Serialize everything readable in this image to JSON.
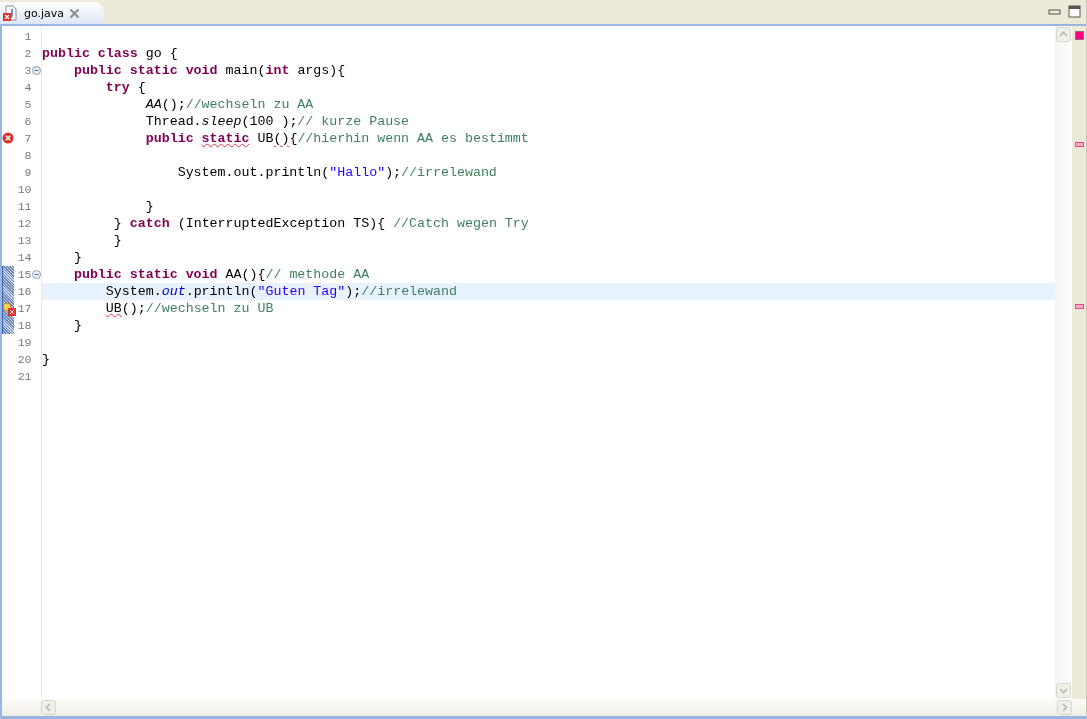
{
  "tab": {
    "title": "go.java",
    "selected": true,
    "has_error": true
  },
  "lines": [
    {
      "number": "1"
    },
    {
      "number": "2",
      "tokens": [
        {
          "kind": "keyword",
          "text": "public class"
        },
        {
          "kind": "plain",
          "text": " go {"
        }
      ]
    },
    {
      "number": "3",
      "expanded": true,
      "tokens": [
        {
          "kind": "keyword",
          "text": "    public static void"
        },
        {
          "kind": "plain",
          "text": " main("
        },
        {
          "kind": "keyword",
          "text": "int"
        },
        {
          "kind": "plain",
          "text": " args){"
        }
      ]
    },
    {
      "number": "4",
      "tokens": [
        {
          "kind": "keyword",
          "text": "        try"
        },
        {
          "kind": "plain",
          "text": " {"
        }
      ]
    },
    {
      "number": "5",
      "tokens": [
        {
          "kind": "italic",
          "text": "             AA"
        },
        {
          "kind": "plain",
          "text": "();"
        },
        {
          "kind": "comment",
          "text": "//wechseln zu AA"
        }
      ]
    },
    {
      "number": "6",
      "tokens": [
        {
          "kind": "plain",
          "text": "             Thread."
        },
        {
          "kind": "italic",
          "text": "sleep"
        },
        {
          "kind": "plain",
          "text": "(100 );"
        },
        {
          "kind": "comment",
          "text": "// kurze Pause"
        }
      ]
    },
    {
      "number": "7",
      "has_error": true,
      "tokens": [
        {
          "kind": "keyword",
          "text": "             public "
        },
        {
          "kind": "keyword",
          "text": "static",
          "error": true
        },
        {
          "kind": "plain",
          "text": " UB"
        },
        {
          "kind": "plain",
          "text": "()",
          "error": true
        },
        {
          "kind": "plain",
          "text": "{"
        },
        {
          "kind": "comment",
          "text": "//hierhin wenn AA es bestimmt"
        }
      ]
    },
    {
      "number": "8"
    },
    {
      "number": "9",
      "tokens": [
        {
          "kind": "plain",
          "text": "                 System.out.println("
        },
        {
          "kind": "string",
          "text": "\"Hallo\""
        },
        {
          "kind": "plain",
          "text": ");"
        },
        {
          "kind": "comment",
          "text": "//irrelewand"
        }
      ]
    },
    {
      "number": "10"
    },
    {
      "number": "11",
      "tokens": [
        {
          "kind": "plain",
          "text": "             }"
        }
      ]
    },
    {
      "number": "12",
      "tokens": [
        {
          "kind": "plain",
          "text": "         } "
        },
        {
          "kind": "keyword",
          "text": "catch"
        },
        {
          "kind": "plain",
          "text": " (InterruptedException TS){ "
        },
        {
          "kind": "comment",
          "text": "//Catch wegen Try"
        }
      ]
    },
    {
      "number": "13",
      "tokens": [
        {
          "kind": "plain",
          "text": "         }"
        }
      ]
    },
    {
      "number": "14",
      "tokens": [
        {
          "kind": "plain",
          "text": "    }"
        }
      ]
    },
    {
      "number": "15",
      "expanded": true,
      "range": true,
      "tokens": [
        {
          "kind": "keyword",
          "text": "    public static void"
        },
        {
          "kind": "plain",
          "text": " AA(){"
        },
        {
          "kind": "comment",
          "text": "// methode AA"
        }
      ]
    },
    {
      "number": "16",
      "range": true,
      "selected": true,
      "tokens": [
        {
          "kind": "plain",
          "text": "        System."
        },
        {
          "kind": "field",
          "text": "out"
        },
        {
          "kind": "plain",
          "text": ".println("
        },
        {
          "kind": "string",
          "text": "\"Guten Tag\""
        },
        {
          "kind": "plain",
          "text": ");"
        },
        {
          "kind": "comment",
          "text": "//irrelewand"
        }
      ]
    },
    {
      "number": "17",
      "has_error": true,
      "quick_fix": true,
      "range": true,
      "tokens": [
        {
          "kind": "plain",
          "text": "        UB",
          "error": true
        },
        {
          "kind": "plain",
          "text": "();"
        },
        {
          "kind": "comment",
          "text": "//wechseln zu UB"
        }
      ]
    },
    {
      "number": "18",
      "range": true,
      "tokens": [
        {
          "kind": "plain",
          "text": "    }"
        }
      ]
    },
    {
      "number": "19"
    },
    {
      "number": "20",
      "tokens": [
        {
          "kind": "plain",
          "text": "}"
        }
      ]
    },
    {
      "number": "21"
    }
  ]
}
